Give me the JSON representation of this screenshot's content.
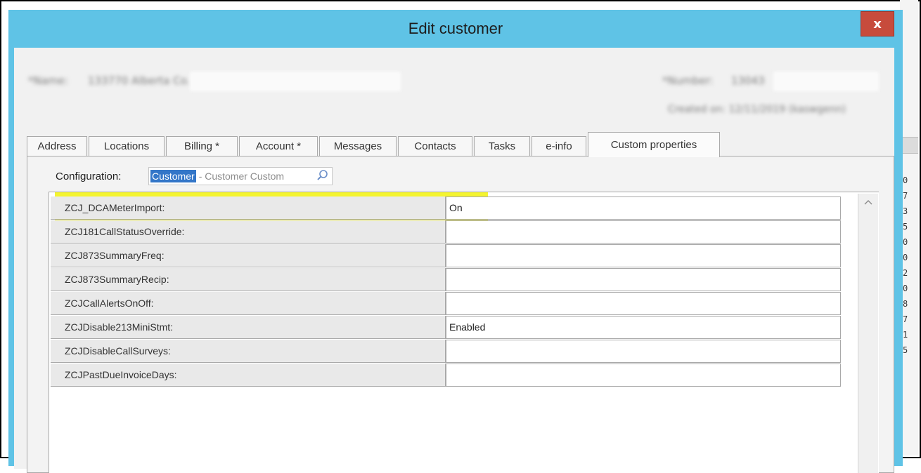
{
  "dialog": {
    "title": "Edit customer",
    "close_label": "x"
  },
  "header": {
    "name_label": "*Name:",
    "name_value": "133770 Alberta Co.",
    "number_label": "*Number:",
    "number_value": "13043",
    "created_text": "Created on: 12/11/2019 (kaswgenn)"
  },
  "tabs": [
    {
      "label": "Address"
    },
    {
      "label": "Locations"
    },
    {
      "label": "Billing *"
    },
    {
      "label": "Account *"
    },
    {
      "label": "Messages"
    },
    {
      "label": "Contacts"
    },
    {
      "label": "Tasks"
    },
    {
      "label": "e-info"
    },
    {
      "label": "Custom properties"
    }
  ],
  "config": {
    "label": "Configuration:",
    "selected": "Customer",
    "rest": "- Customer Custom"
  },
  "properties": [
    {
      "name": "ZCJ_DCAMeterImport:",
      "value": "On"
    },
    {
      "name": "ZCJ181CallStatusOverride:",
      "value": ""
    },
    {
      "name": "ZCJ873SummaryFreq:",
      "value": ""
    },
    {
      "name": "ZCJ873SummaryRecip:",
      "value": ""
    },
    {
      "name": "ZCJCallAlertsOnOff:",
      "value": ""
    },
    {
      "name": "ZCJDisable213MiniStmt:",
      "value": "Enabled"
    },
    {
      "name": "ZCJDisableCallSurveys:",
      "value": ""
    },
    {
      "name": "ZCJPastDueInvoiceDays:",
      "value": ""
    }
  ],
  "background_digits": [
    "0",
    "7",
    "3",
    "5",
    "0",
    "0",
    "2",
    "0",
    "8",
    "7",
    "1",
    "5"
  ],
  "colors": {
    "title_bar": "#5fc3e6",
    "close_button": "#c74b3c",
    "highlight": "#f3f318",
    "selection": "#3376c8"
  },
  "icons": {
    "search": "magnifier-icon",
    "scroll_up": "chevron-up-icon"
  }
}
